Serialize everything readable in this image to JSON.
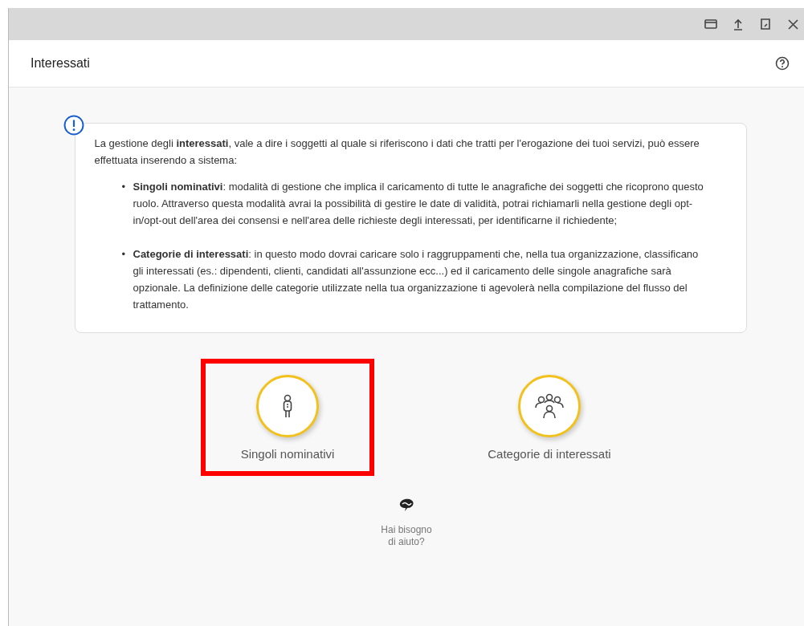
{
  "title_bar": {
    "buttons": [
      {
        "kind": "window"
      },
      {
        "kind": "upload"
      },
      {
        "kind": "bookmark"
      },
      {
        "kind": "close"
      }
    ]
  },
  "header": {
    "title": "Interessati"
  },
  "info": {
    "intro": "La gestione degli **interessati**, vale a dire i soggetti al quale si riferiscono i dati che tratti per l'erogazione dei tuoi servizi, può essere effettuata inserendo a sistema:",
    "items": [
      {
        "bullet": "•",
        "text": "**Singoli nominativi**: modalità di gestione che implica il caricamento di tutte le anagrafiche dei soggetti che ricoprono questo ruolo. Attraverso questa modalità avrai la possibilità di gestire le date di validità, potrai richiamarli nella gestione degli opt-in/opt-out dell'area dei consensi e nell'area delle richieste degli interessati, per identificarne il richiedente;"
      },
      {
        "bullet": "•",
        "text": "**Categorie di interessati**: in questo modo dovrai caricare solo i raggruppamenti che, nella tua organizzazione, classificano gli interessati (es.: dipendenti, clienti, candidati all'assunzione ecc...) ed il caricamento delle singole anagrafiche sarà opzionale. La definizione delle categorie utilizzate nella tua organizzazione ti agevolerà nella compilazione del flusso del trattamento."
      }
    ]
  },
  "options": [
    {
      "kind": "person",
      "label": "Singoli nominativi",
      "highlighted": true
    },
    {
      "kind": "group",
      "label": "Categorie di interessati",
      "highlighted": false
    }
  ],
  "help": {
    "label": "Hai bisogno di aiuto?"
  }
}
